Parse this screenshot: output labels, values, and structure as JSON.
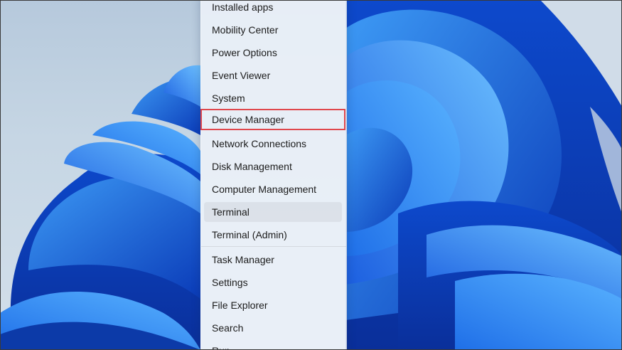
{
  "menu": {
    "items": [
      {
        "label": "Installed apps"
      },
      {
        "label": "Mobility Center"
      },
      {
        "label": "Power Options"
      },
      {
        "label": "Event Viewer"
      },
      {
        "label": "System"
      },
      {
        "label": "Device Manager",
        "highlighted": true
      },
      {
        "label": "Network Connections"
      },
      {
        "label": "Disk Management"
      },
      {
        "label": "Computer Management"
      },
      {
        "label": "Terminal",
        "hovered": true
      },
      {
        "label": "Terminal (Admin)"
      },
      {
        "label": "Task Manager"
      },
      {
        "label": "Settings"
      },
      {
        "label": "File Explorer"
      },
      {
        "label": "Search"
      },
      {
        "label": "Run"
      }
    ]
  },
  "colors": {
    "highlight_border": "#e0474c",
    "wallpaper_accent": "#1a64e6"
  }
}
